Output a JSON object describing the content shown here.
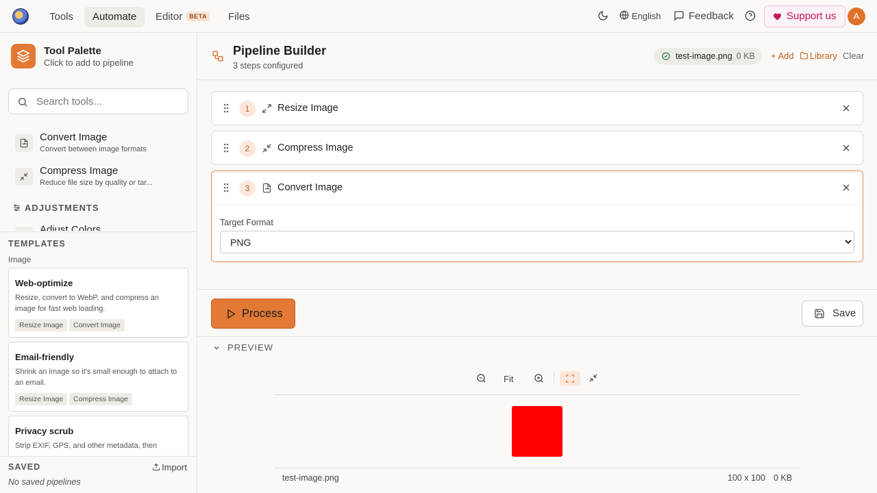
{
  "nav": {
    "tabs": [
      {
        "label": "Tools"
      },
      {
        "label": "Automate"
      },
      {
        "label": "Editor",
        "badge": "BETA"
      },
      {
        "label": "Files"
      }
    ],
    "language": "English",
    "feedback": "Feedback",
    "support": "Support us",
    "avatar_initial": "A"
  },
  "palette": {
    "title": "Tool Palette",
    "subtitle": "Click to add to pipeline",
    "search_placeholder": "Search tools...",
    "tools": [
      {
        "name": "Convert Image",
        "desc": "Convert between image formats",
        "icon": "file-convert-icon"
      },
      {
        "name": "Compress Image",
        "desc": "Reduce file size by quality or tar...",
        "icon": "compress-icon"
      }
    ],
    "section": "ADJUSTMENTS",
    "partial_tool": "Adjust Colors"
  },
  "templates": {
    "heading": "TEMPLATES",
    "category": "Image",
    "items": [
      {
        "title": "Web-optimize",
        "desc": "Resize, convert to WebP, and compress an image for fast web loading.",
        "tags": [
          "Resize Image",
          "Convert Image"
        ]
      },
      {
        "title": "Email-friendly",
        "desc": "Shrink an image so it's small enough to attach to an email.",
        "tags": [
          "Resize Image",
          "Compress Image"
        ]
      },
      {
        "title": "Privacy scrub",
        "desc": "Strip EXIF, GPS, and other metadata, then",
        "tags": []
      }
    ]
  },
  "saved": {
    "heading": "SAVED",
    "import": "Import",
    "empty": "No saved pipelines"
  },
  "pipeline": {
    "title": "Pipeline Builder",
    "subtitle": "3 steps configured",
    "file_name": "test-image.png",
    "file_size": "0 KB",
    "add": "+ Add",
    "library": "Library",
    "clear": "Clear",
    "steps": [
      {
        "num": "1",
        "name": "Resize Image",
        "icon": "expand-icon"
      },
      {
        "num": "2",
        "name": "Compress Image",
        "icon": "compress-icon"
      },
      {
        "num": "3",
        "name": "Convert Image",
        "icon": "file-convert-icon"
      }
    ],
    "target_format_label": "Target Format",
    "target_format_value": "PNG",
    "process": "Process",
    "save": "Save"
  },
  "preview": {
    "heading": "PREVIEW",
    "fit": "Fit",
    "file_name": "test-image.png",
    "dims": "100 x 100",
    "size": "0 KB",
    "image_color": "#ff0000"
  },
  "colors": {
    "accent": "#e27a35",
    "support": "#c2185b"
  }
}
